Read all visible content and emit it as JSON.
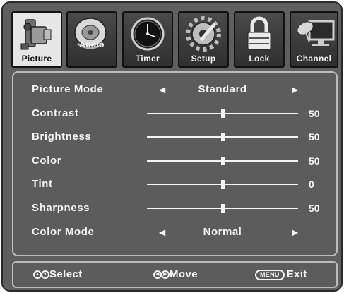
{
  "tabs": [
    {
      "label": "Picture",
      "icon": "camera-icon",
      "active": true
    },
    {
      "label": "Audio",
      "icon": "speaker-disc-icon",
      "active": false
    },
    {
      "label": "Timer",
      "icon": "clock-icon",
      "active": false
    },
    {
      "label": "Setup",
      "icon": "gear-wrench-icon",
      "active": false
    },
    {
      "label": "Lock",
      "icon": "padlock-icon",
      "active": false
    },
    {
      "label": "Channel",
      "icon": "satellite-dish-tv-icon",
      "active": false
    }
  ],
  "settings": {
    "picture_mode": {
      "label": "Picture Mode",
      "value": "Standard"
    },
    "contrast": {
      "label": "Contrast",
      "value": "50",
      "level": 0.5
    },
    "brightness": {
      "label": "Brightness",
      "value": "50",
      "level": 0.5
    },
    "color": {
      "label": "Color",
      "value": "50",
      "level": 0.5
    },
    "tint": {
      "label": "Tint",
      "value": "0",
      "level": 0.5
    },
    "sharpness": {
      "label": "Sharpness",
      "value": "50",
      "level": 0.5
    },
    "color_mode": {
      "label": "Color Mode",
      "value": "Normal"
    }
  },
  "footer": {
    "select": "Select",
    "move": "Move",
    "menu_key": "MENU",
    "exit": "Exit"
  },
  "colors": {
    "background": "#5f5f5f",
    "text": "#f4f4f4",
    "active_tab": "#e6e6e6"
  }
}
